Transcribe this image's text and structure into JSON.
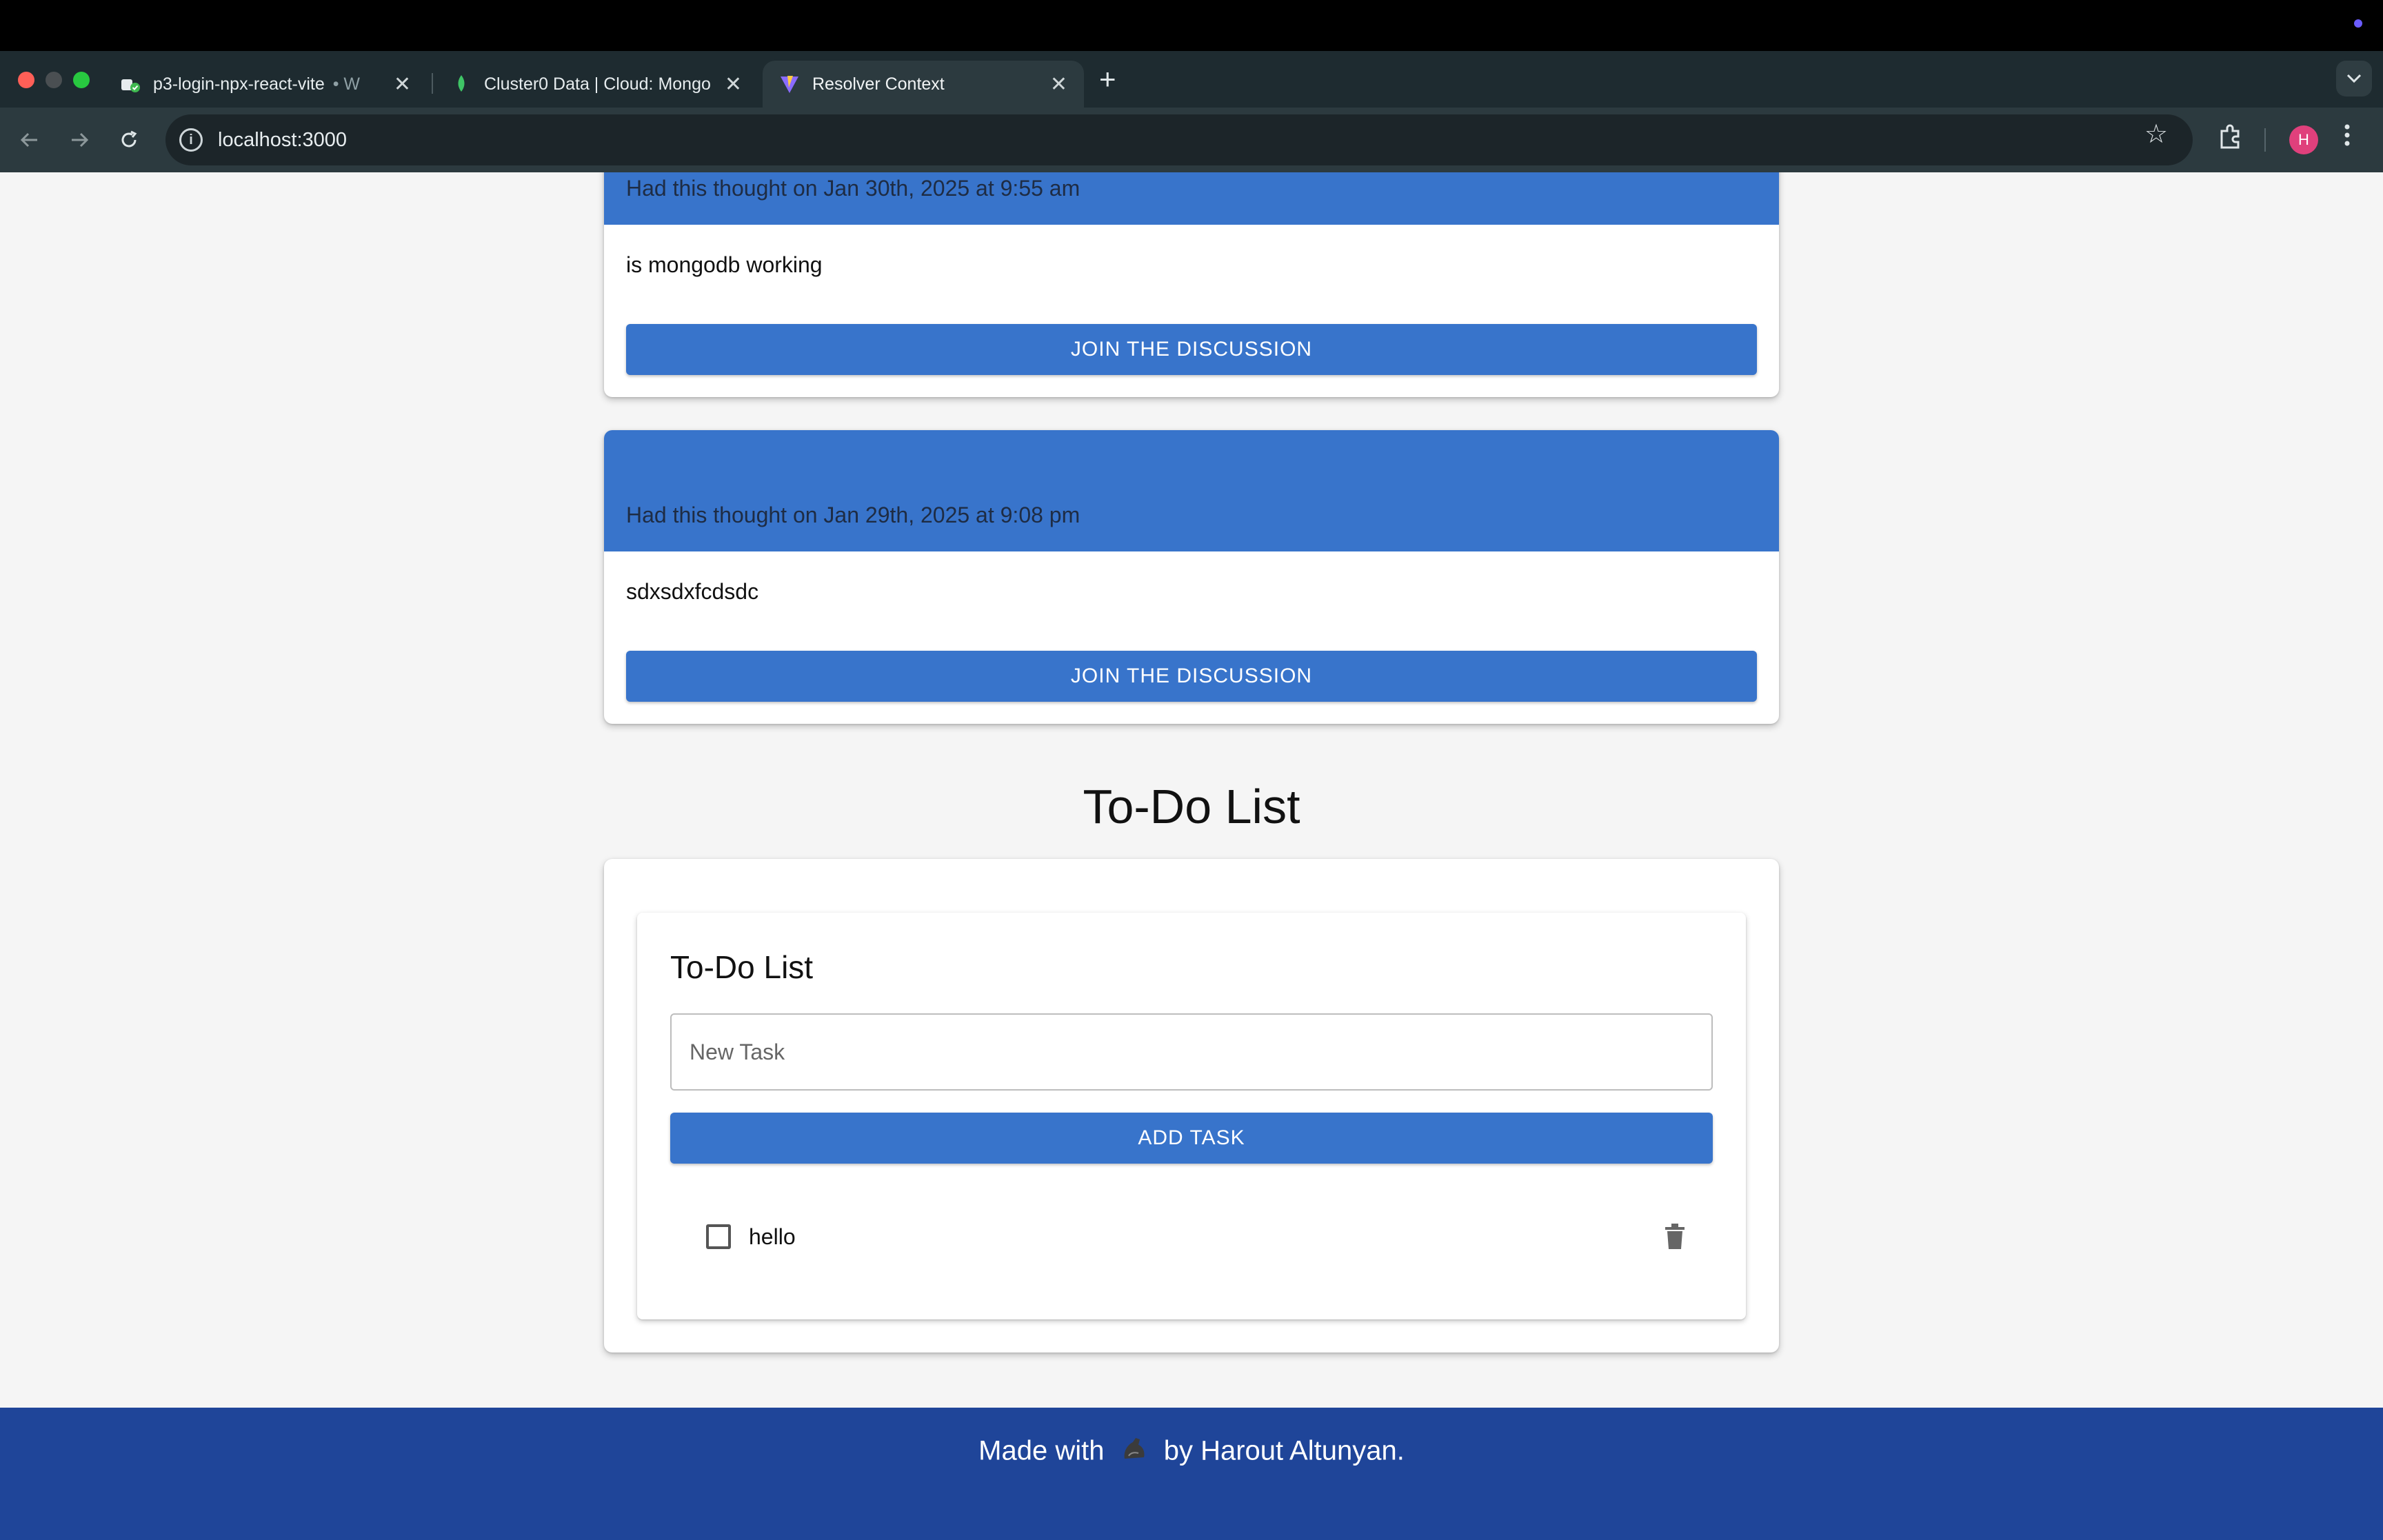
{
  "browser": {
    "tabs": [
      {
        "title": "p3-login-npx-react-vite",
        "suffix": "• W",
        "active": false
      },
      {
        "title": "Cluster0 Data | Cloud: Mongo",
        "active": false
      },
      {
        "title": "Resolver Context",
        "active": true
      }
    ],
    "close_glyph": "✕",
    "new_tab_glyph": "+",
    "url": "localhost:3000",
    "profile_initial": "H",
    "colors": {
      "profile": "#e0407c"
    }
  },
  "thoughts": [
    {
      "header": "Had this thought on Jan 30th, 2025 at 9:55 am",
      "text": "is mongodb working",
      "button_label": "JOIN THE DISCUSSION"
    },
    {
      "header": "Had this thought on Jan 29th, 2025 at 9:08 pm",
      "text": "sdxsdxfcdsdc",
      "button_label": "JOIN THE DISCUSSION"
    }
  ],
  "todo": {
    "section_title": "To-Do List",
    "card_title": "To-Do List",
    "input_placeholder": "New Task",
    "add_button_label": "ADD TASK",
    "items": [
      {
        "text": "hello",
        "checked": false
      }
    ]
  },
  "footer": {
    "text_before": "Made with",
    "text_after": "by Harout Altunyan."
  },
  "theme": {
    "primary": "#3874cb",
    "footer_bg": "#1f4599"
  }
}
